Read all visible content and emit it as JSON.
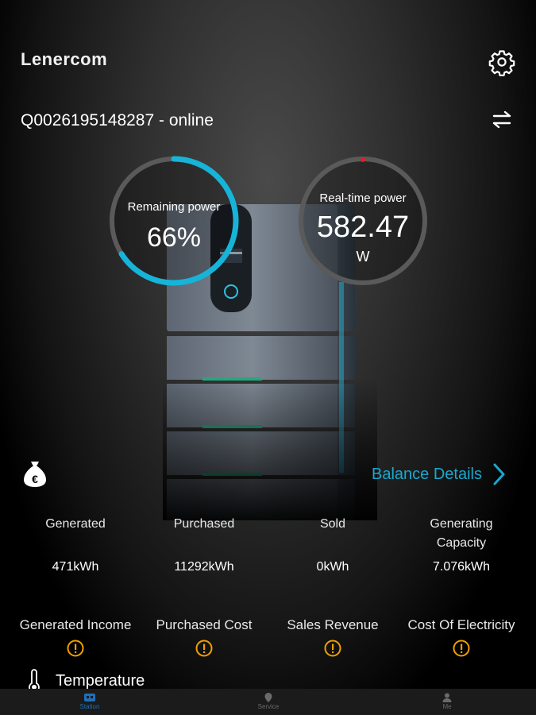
{
  "header": {
    "brand": "Lenercom",
    "settings_icon": "gear-icon"
  },
  "device": {
    "status_line": "Q0026195148287 - online",
    "switch_icon": "swap-arrows-icon"
  },
  "gauges": {
    "remaining": {
      "title": "Remaining power",
      "value": "66%",
      "level": 0.66,
      "color": "#17b4d9"
    },
    "realtime": {
      "title": "Real-time power",
      "value": "582.47",
      "unit": "W",
      "indicator_color": "#e02020"
    }
  },
  "balance": {
    "link_label": "Balance Details",
    "money_icon": "euro-moneybag-icon"
  },
  "stats": [
    {
      "label": "Generated",
      "value": "471kWh"
    },
    {
      "label": "Purchased",
      "value": "11292kWh"
    },
    {
      "label": "Sold",
      "value": "0kWh"
    },
    {
      "label": "Generating Capacity",
      "value": "7.076kWh"
    }
  ],
  "financials": [
    {
      "label": "Generated Income"
    },
    {
      "label": "Purchased Cost"
    },
    {
      "label": "Sales Revenue"
    },
    {
      "label": "Cost Of Electricity"
    }
  ],
  "temperature": {
    "label": "Temperature",
    "icon": "thermometer-icon"
  },
  "nav": [
    {
      "label": "Station",
      "icon": "station-icon",
      "active": true
    },
    {
      "label": "Service",
      "icon": "location-pin-icon",
      "active": false
    },
    {
      "label": "Me",
      "icon": "person-icon",
      "active": false
    }
  ],
  "colors": {
    "accent": "#1aa8cf",
    "warning": "#f0a000",
    "ring_track": "#5a5a5a"
  }
}
